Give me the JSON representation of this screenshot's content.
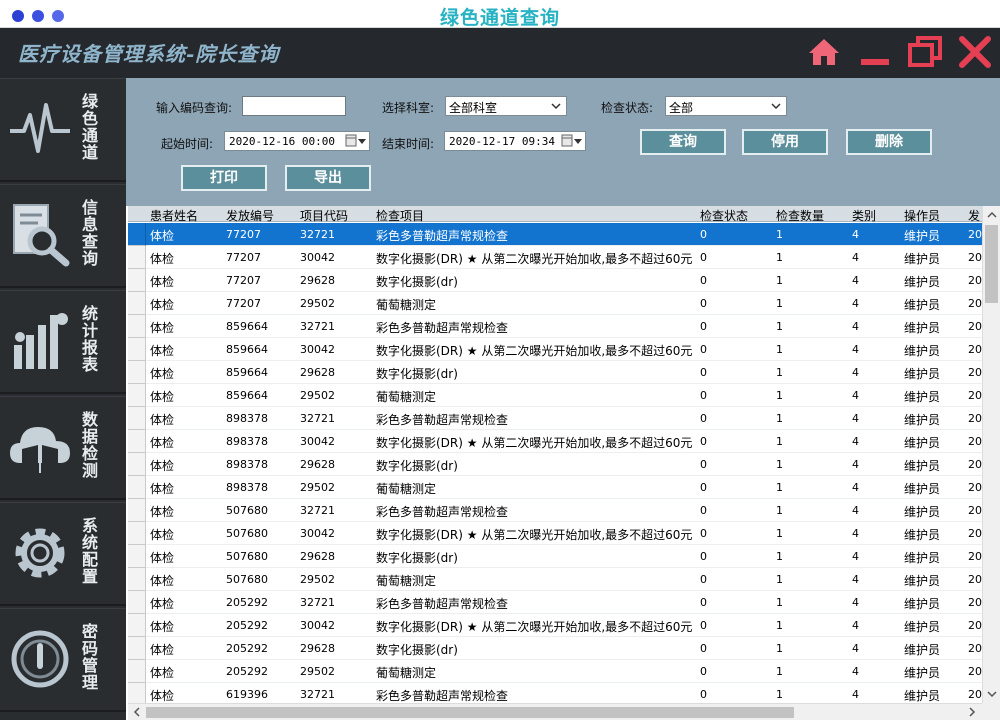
{
  "window": {
    "title": "绿色通道查询",
    "dot_colors": [
      "#2e3fd6",
      "#3b4fe0",
      "#5568ea"
    ]
  },
  "header": {
    "app_title": "医疗设备管理系统-院长查询",
    "icons": [
      "home-icon",
      "minimize-icon",
      "maximize-icon",
      "close-icon"
    ],
    "icon_color": "#f06679"
  },
  "sidebar": {
    "items": [
      {
        "label": "绿色通道",
        "icon": "heartbeat-icon"
      },
      {
        "label": "信息查询",
        "icon": "document-search-icon"
      },
      {
        "label": "统计报表",
        "icon": "people-chart-icon"
      },
      {
        "label": "数据检测",
        "icon": "cloud-book-icon"
      },
      {
        "label": "系统配置",
        "icon": "gear-icon"
      },
      {
        "label": "密码管理",
        "icon": "power-icon"
      }
    ]
  },
  "filters": {
    "code_label": "输入编码查询:",
    "code_value": "",
    "dept_label": "选择科室:",
    "dept_value": "全部科室",
    "status_label": "检查状态:",
    "status_value": "全部",
    "start_label": "起始时间:",
    "start_value": "2020-12-16 00:00",
    "end_label": "结束时间:",
    "end_value": "2020-12-17 09:34"
  },
  "buttons": {
    "query": "查询",
    "disable": "停用",
    "delete": "删除",
    "print": "打印",
    "export": "导出"
  },
  "table": {
    "columns": [
      "患者姓名",
      "发放编号",
      "项目代码",
      "检查项目",
      "检查状态",
      "检查数量",
      "类别",
      "操作员",
      "发"
    ],
    "selected_row": 0,
    "rows": [
      [
        "体检",
        "77207",
        "32721",
        "彩色多普勒超声常规检查",
        "0",
        "1",
        "4",
        "维护员",
        "20"
      ],
      [
        "体检",
        "77207",
        "30042",
        "数字化摄影(DR) ★ 从第二次曝光开始加收,最多不超过60元",
        "0",
        "1",
        "4",
        "维护员",
        "20"
      ],
      [
        "体检",
        "77207",
        "29628",
        "数字化摄影(dr)",
        "0",
        "1",
        "4",
        "维护员",
        "20"
      ],
      [
        "体检",
        "77207",
        "29502",
        "葡萄糖测定",
        "0",
        "1",
        "4",
        "维护员",
        "20"
      ],
      [
        "体检",
        "859664",
        "32721",
        "彩色多普勒超声常规检查",
        "0",
        "1",
        "4",
        "维护员",
        "20"
      ],
      [
        "体检",
        "859664",
        "30042",
        "数字化摄影(DR) ★ 从第二次曝光开始加收,最多不超过60元",
        "0",
        "1",
        "4",
        "维护员",
        "20"
      ],
      [
        "体检",
        "859664",
        "29628",
        "数字化摄影(dr)",
        "0",
        "1",
        "4",
        "维护员",
        "20"
      ],
      [
        "体检",
        "859664",
        "29502",
        "葡萄糖测定",
        "0",
        "1",
        "4",
        "维护员",
        "20"
      ],
      [
        "体检",
        "898378",
        "32721",
        "彩色多普勒超声常规检查",
        "0",
        "1",
        "4",
        "维护员",
        "20"
      ],
      [
        "体检",
        "898378",
        "30042",
        "数字化摄影(DR) ★ 从第二次曝光开始加收,最多不超过60元",
        "0",
        "1",
        "4",
        "维护员",
        "20"
      ],
      [
        "体检",
        "898378",
        "29628",
        "数字化摄影(dr)",
        "0",
        "1",
        "4",
        "维护员",
        "20"
      ],
      [
        "体检",
        "898378",
        "29502",
        "葡萄糖测定",
        "0",
        "1",
        "4",
        "维护员",
        "20"
      ],
      [
        "体检",
        "507680",
        "32721",
        "彩色多普勒超声常规检查",
        "0",
        "1",
        "4",
        "维护员",
        "20"
      ],
      [
        "体检",
        "507680",
        "30042",
        "数字化摄影(DR) ★ 从第二次曝光开始加收,最多不超过60元",
        "0",
        "1",
        "4",
        "维护员",
        "20"
      ],
      [
        "体检",
        "507680",
        "29628",
        "数字化摄影(dr)",
        "0",
        "1",
        "4",
        "维护员",
        "20"
      ],
      [
        "体检",
        "507680",
        "29502",
        "葡萄糖测定",
        "0",
        "1",
        "4",
        "维护员",
        "20"
      ],
      [
        "体检",
        "205292",
        "32721",
        "彩色多普勒超声常规检查",
        "0",
        "1",
        "4",
        "维护员",
        "20"
      ],
      [
        "体检",
        "205292",
        "30042",
        "数字化摄影(DR) ★ 从第二次曝光开始加收,最多不超过60元",
        "0",
        "1",
        "4",
        "维护员",
        "20"
      ],
      [
        "体检",
        "205292",
        "29628",
        "数字化摄影(dr)",
        "0",
        "1",
        "4",
        "维护员",
        "20"
      ],
      [
        "体检",
        "205292",
        "29502",
        "葡萄糖测定",
        "0",
        "1",
        "4",
        "维护员",
        "20"
      ],
      [
        "体检",
        "619396",
        "32721",
        "彩色多普勒超声常规检查",
        "0",
        "1",
        "4",
        "维护员",
        "20"
      ]
    ]
  },
  "colors": {
    "panel_bg": "#8ea5b6",
    "button_bg": "#5b8f9b",
    "selection": "#1374d0",
    "sidebar_bg": "#2a2d30",
    "title_color": "#27b3c4"
  }
}
